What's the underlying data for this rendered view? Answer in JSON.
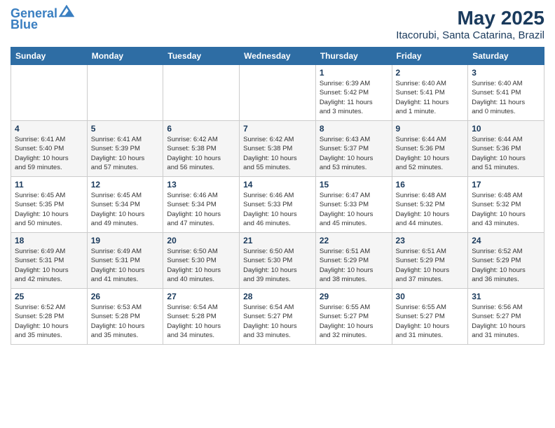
{
  "header": {
    "logo_line1": "General",
    "logo_line2": "Blue",
    "title": "May 2025",
    "subtitle": "Itacorubi, Santa Catarina, Brazil"
  },
  "weekdays": [
    "Sunday",
    "Monday",
    "Tuesday",
    "Wednesday",
    "Thursday",
    "Friday",
    "Saturday"
  ],
  "weeks": [
    [
      {
        "day": "",
        "info": ""
      },
      {
        "day": "",
        "info": ""
      },
      {
        "day": "",
        "info": ""
      },
      {
        "day": "",
        "info": ""
      },
      {
        "day": "1",
        "info": "Sunrise: 6:39 AM\nSunset: 5:42 PM\nDaylight: 11 hours\nand 3 minutes."
      },
      {
        "day": "2",
        "info": "Sunrise: 6:40 AM\nSunset: 5:41 PM\nDaylight: 11 hours\nand 1 minute."
      },
      {
        "day": "3",
        "info": "Sunrise: 6:40 AM\nSunset: 5:41 PM\nDaylight: 11 hours\nand 0 minutes."
      }
    ],
    [
      {
        "day": "4",
        "info": "Sunrise: 6:41 AM\nSunset: 5:40 PM\nDaylight: 10 hours\nand 59 minutes."
      },
      {
        "day": "5",
        "info": "Sunrise: 6:41 AM\nSunset: 5:39 PM\nDaylight: 10 hours\nand 57 minutes."
      },
      {
        "day": "6",
        "info": "Sunrise: 6:42 AM\nSunset: 5:38 PM\nDaylight: 10 hours\nand 56 minutes."
      },
      {
        "day": "7",
        "info": "Sunrise: 6:42 AM\nSunset: 5:38 PM\nDaylight: 10 hours\nand 55 minutes."
      },
      {
        "day": "8",
        "info": "Sunrise: 6:43 AM\nSunset: 5:37 PM\nDaylight: 10 hours\nand 53 minutes."
      },
      {
        "day": "9",
        "info": "Sunrise: 6:44 AM\nSunset: 5:36 PM\nDaylight: 10 hours\nand 52 minutes."
      },
      {
        "day": "10",
        "info": "Sunrise: 6:44 AM\nSunset: 5:36 PM\nDaylight: 10 hours\nand 51 minutes."
      }
    ],
    [
      {
        "day": "11",
        "info": "Sunrise: 6:45 AM\nSunset: 5:35 PM\nDaylight: 10 hours\nand 50 minutes."
      },
      {
        "day": "12",
        "info": "Sunrise: 6:45 AM\nSunset: 5:34 PM\nDaylight: 10 hours\nand 49 minutes."
      },
      {
        "day": "13",
        "info": "Sunrise: 6:46 AM\nSunset: 5:34 PM\nDaylight: 10 hours\nand 47 minutes."
      },
      {
        "day": "14",
        "info": "Sunrise: 6:46 AM\nSunset: 5:33 PM\nDaylight: 10 hours\nand 46 minutes."
      },
      {
        "day": "15",
        "info": "Sunrise: 6:47 AM\nSunset: 5:33 PM\nDaylight: 10 hours\nand 45 minutes."
      },
      {
        "day": "16",
        "info": "Sunrise: 6:48 AM\nSunset: 5:32 PM\nDaylight: 10 hours\nand 44 minutes."
      },
      {
        "day": "17",
        "info": "Sunrise: 6:48 AM\nSunset: 5:32 PM\nDaylight: 10 hours\nand 43 minutes."
      }
    ],
    [
      {
        "day": "18",
        "info": "Sunrise: 6:49 AM\nSunset: 5:31 PM\nDaylight: 10 hours\nand 42 minutes."
      },
      {
        "day": "19",
        "info": "Sunrise: 6:49 AM\nSunset: 5:31 PM\nDaylight: 10 hours\nand 41 minutes."
      },
      {
        "day": "20",
        "info": "Sunrise: 6:50 AM\nSunset: 5:30 PM\nDaylight: 10 hours\nand 40 minutes."
      },
      {
        "day": "21",
        "info": "Sunrise: 6:50 AM\nSunset: 5:30 PM\nDaylight: 10 hours\nand 39 minutes."
      },
      {
        "day": "22",
        "info": "Sunrise: 6:51 AM\nSunset: 5:29 PM\nDaylight: 10 hours\nand 38 minutes."
      },
      {
        "day": "23",
        "info": "Sunrise: 6:51 AM\nSunset: 5:29 PM\nDaylight: 10 hours\nand 37 minutes."
      },
      {
        "day": "24",
        "info": "Sunrise: 6:52 AM\nSunset: 5:29 PM\nDaylight: 10 hours\nand 36 minutes."
      }
    ],
    [
      {
        "day": "25",
        "info": "Sunrise: 6:52 AM\nSunset: 5:28 PM\nDaylight: 10 hours\nand 35 minutes."
      },
      {
        "day": "26",
        "info": "Sunrise: 6:53 AM\nSunset: 5:28 PM\nDaylight: 10 hours\nand 35 minutes."
      },
      {
        "day": "27",
        "info": "Sunrise: 6:54 AM\nSunset: 5:28 PM\nDaylight: 10 hours\nand 34 minutes."
      },
      {
        "day": "28",
        "info": "Sunrise: 6:54 AM\nSunset: 5:27 PM\nDaylight: 10 hours\nand 33 minutes."
      },
      {
        "day": "29",
        "info": "Sunrise: 6:55 AM\nSunset: 5:27 PM\nDaylight: 10 hours\nand 32 minutes."
      },
      {
        "day": "30",
        "info": "Sunrise: 6:55 AM\nSunset: 5:27 PM\nDaylight: 10 hours\nand 31 minutes."
      },
      {
        "day": "31",
        "info": "Sunrise: 6:56 AM\nSunset: 5:27 PM\nDaylight: 10 hours\nand 31 minutes."
      }
    ]
  ]
}
